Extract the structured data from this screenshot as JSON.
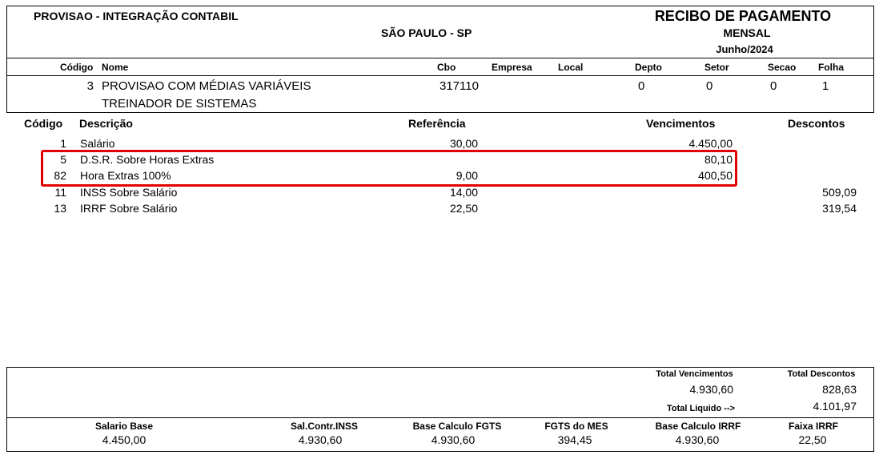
{
  "header": {
    "company": "PROVISAO - INTEGRAÇÃO CONTABIL",
    "city": "SÃO PAULO - SP",
    "title": "RECIBO DE PAGAMENTO",
    "period_type": "MENSAL",
    "period": "Junho/2024"
  },
  "employee_header": {
    "codigo": "Código",
    "nome": "Nome",
    "cbo": "Cbo",
    "empresa": "Empresa",
    "local": "Local",
    "depto": "Depto",
    "setor": "Setor",
    "secao": "Secao",
    "folha": "Folha"
  },
  "employee": {
    "codigo": "3",
    "nome": "PROVISAO COM MÉDIAS VARIÁVEIS",
    "cargo": "TREINADOR DE SISTEMAS",
    "cbo": "317110",
    "depto": "0",
    "setor": "0",
    "secao": "0",
    "folha": "1"
  },
  "items_header": {
    "codigo": "Código",
    "descricao": "Descrição",
    "referencia": "Referência",
    "vencimentos": "Vencimentos",
    "descontos": "Descontos"
  },
  "items": [
    {
      "codigo": "1",
      "descricao": "Salário",
      "referencia": "30,00",
      "vencimentos": "4.450,00",
      "descontos": ""
    },
    {
      "codigo": "5",
      "descricao": "D.S.R. Sobre Horas Extras",
      "referencia": "",
      "vencimentos": "80,10",
      "descontos": ""
    },
    {
      "codigo": "82",
      "descricao": "Hora Extras 100%",
      "referencia": "9,00",
      "vencimentos": "400,50",
      "descontos": ""
    },
    {
      "codigo": "11",
      "descricao": "INSS Sobre Salário",
      "referencia": "14,00",
      "vencimentos": "",
      "descontos": "509,09"
    },
    {
      "codigo": "13",
      "descricao": "IRRF Sobre Salário",
      "referencia": "22,50",
      "vencimentos": "",
      "descontos": "319,54"
    }
  ],
  "highlight_color": "#e00000",
  "totals": {
    "total_vencimentos_label": "Total Vencimentos",
    "total_vencimentos": "4.930,60",
    "total_descontos_label": "Total Descontos",
    "total_descontos": "828,63",
    "total_liquido_label": "Total Liquido -->",
    "total_liquido": "4.101,97"
  },
  "footer": [
    {
      "label": "Salario Base",
      "value": "4.450,00"
    },
    {
      "label": "Sal.Contr.INSS",
      "value": "4.930,60"
    },
    {
      "label": "Base Calculo FGTS",
      "value": "4.930,60"
    },
    {
      "label": "FGTS do MES",
      "value": "394,45"
    },
    {
      "label": "Base Calculo IRRF",
      "value": "4.930,60"
    },
    {
      "label": "Faixa IRRF",
      "value": "22,50"
    }
  ]
}
